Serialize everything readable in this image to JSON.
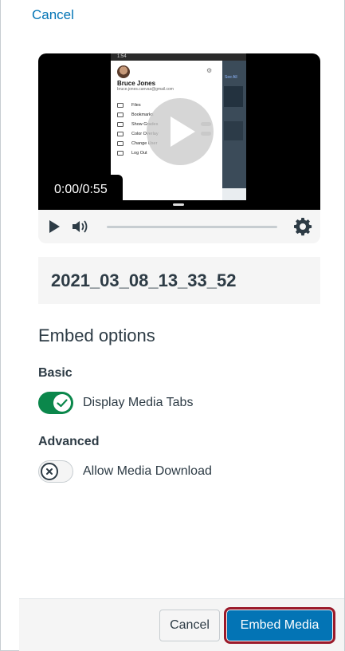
{
  "header": {
    "cancel_label": "Cancel"
  },
  "player": {
    "time_display": "0:00/0:55",
    "phone_preview": {
      "status_time": "1:54",
      "user_name": "Bruce Jones",
      "user_email": "bruce.jones.canvas@gmail.com",
      "menu": [
        "Files",
        "Bookmarks",
        "Show Grades",
        "Color Overlay",
        "Change User",
        "Log Out"
      ],
      "see_all": "See All"
    },
    "icons": {
      "play": "play-icon",
      "volume": "volume-icon",
      "settings": "gear-icon"
    }
  },
  "media": {
    "title": "2021_03_08_13_33_52"
  },
  "embed_options": {
    "heading": "Embed options",
    "basic": {
      "label": "Basic",
      "option_label": "Display Media Tabs",
      "enabled": true
    },
    "advanced": {
      "label": "Advanced",
      "option_label": "Allow Media Download",
      "enabled": false
    }
  },
  "footer": {
    "cancel_label": "Cancel",
    "embed_label": "Embed Media"
  },
  "colors": {
    "link": "#0374b5",
    "toggle_on": "#0b874b",
    "primary_button": "#0374b5",
    "focus_ring": "#9b1a2a",
    "text": "#2d3b45"
  }
}
